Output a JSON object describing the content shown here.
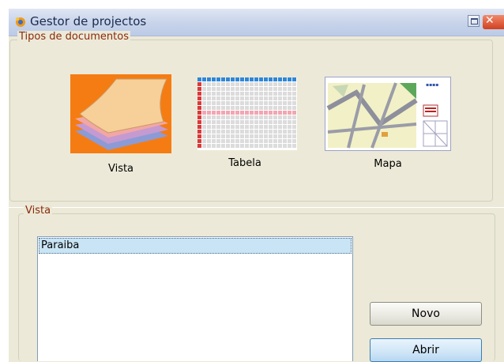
{
  "window": {
    "title": "Gestor de projectos"
  },
  "doc_types": {
    "legend": "Tipos de documentos",
    "items": [
      {
        "label": "Vista",
        "icon": "view-icon"
      },
      {
        "label": "Tabela",
        "icon": "table-icon"
      },
      {
        "label": "Mapa",
        "icon": "map-icon"
      }
    ]
  },
  "documents": {
    "legend": "Vista",
    "list": [
      "Paraiba"
    ],
    "selected_index": 0
  },
  "buttons": {
    "new_label": "Novo",
    "open_label": "Abrir"
  },
  "colors": {
    "titlebar": "#c7d3ea",
    "selection": "#c9e4f4",
    "legend_text": "#8a2a0a",
    "view_icon_bg": "#f57c12"
  }
}
